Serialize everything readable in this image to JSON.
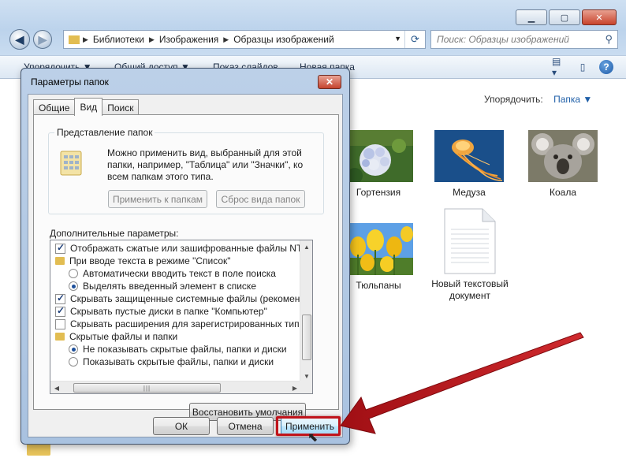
{
  "explorer": {
    "window_controls": [
      "▁",
      "▢",
      "✕"
    ],
    "breadcrumbs": [
      "Библиотеки",
      "Изображения",
      "Образцы изображений"
    ],
    "search_placeholder": "Поиск: Образцы изображений",
    "commands": [
      "Упорядочить ▼",
      "Общий доступ ▼",
      "Показ слайдов",
      "Новая папка"
    ],
    "arrange_label": "Упорядочить:",
    "arrange_value": "Папка ▼",
    "files": [
      {
        "name": "Гортензия",
        "icon": "hydrangea-image"
      },
      {
        "name": "Медуза",
        "icon": "jellyfish-image"
      },
      {
        "name": "Коала",
        "icon": "koala-image"
      },
      {
        "name": "Тюльпаны",
        "icon": "tulips-image"
      },
      {
        "name": "Новый текстовый документ",
        "icon": "text-document-icon"
      }
    ]
  },
  "dialog": {
    "title": "Параметры папок",
    "close_glyph": "✕",
    "tabs": [
      "Общие",
      "Вид",
      "Поиск"
    ],
    "active_tab": "Вид",
    "folder_view": {
      "legend": "Представление папок",
      "description": "Можно применить вид, выбранный для этой папки, например, \"Таблица\" или \"Значки\", ко всем папкам этого типа.",
      "apply_button": "Применить к папкам",
      "reset_button": "Сброс вида папок"
    },
    "advanced_label": "Дополнительные параметры:",
    "settings": [
      {
        "type": "checkbox",
        "checked": true,
        "indent": 0,
        "label": "Отображать сжатые или зашифрованные файлы NTFS другим цветом"
      },
      {
        "type": "folder",
        "indent": 0,
        "label": "При вводе текста в режиме \"Список\""
      },
      {
        "type": "radio",
        "checked": false,
        "indent": 1,
        "label": "Автоматически вводить текст в поле поиска"
      },
      {
        "type": "radio",
        "checked": true,
        "indent": 1,
        "label": "Выделять введенный элемент в списке"
      },
      {
        "type": "checkbox",
        "checked": true,
        "indent": 0,
        "label": "Скрывать защищенные системные файлы (рекомендуется)"
      },
      {
        "type": "checkbox",
        "checked": true,
        "indent": 0,
        "label": "Скрывать пустые диски в папке \"Компьютер\""
      },
      {
        "type": "checkbox",
        "checked": false,
        "indent": 0,
        "label": "Скрывать расширения для зарегистрированных типов файлов"
      },
      {
        "type": "folder",
        "indent": 0,
        "label": "Скрытые файлы и папки"
      },
      {
        "type": "radio",
        "checked": true,
        "indent": 1,
        "label": "Не показывать скрытые файлы, папки и диски"
      },
      {
        "type": "radio",
        "checked": false,
        "indent": 1,
        "label": "Показывать скрытые файлы, папки и диски"
      }
    ],
    "restore_button": "Восстановить умолчания",
    "ok_button": "ОК",
    "cancel_button": "Отмена",
    "apply_button": "Применить"
  },
  "annotation": {
    "color": "#c0141b"
  }
}
